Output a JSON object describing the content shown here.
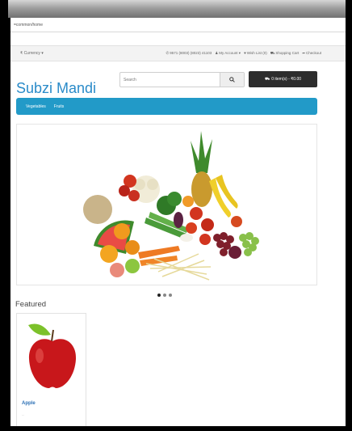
{
  "browser": {
    "url": "=common/home"
  },
  "topbar": {
    "currency": "₹ Currency ▾",
    "phone": "9571 (8003) (8023) 41103",
    "account": "My Account ▾",
    "wishlist": "Wish List (0)",
    "cart_link": "Shopping Cart",
    "checkout": "Checkout"
  },
  "header": {
    "logo": "Subzi Mandi",
    "search_placeholder": "Search",
    "cart_button": "0 item(s) - ₹0.00"
  },
  "nav": {
    "items": [
      "Vegetables",
      "Fruits"
    ]
  },
  "carousel": {
    "slides": 3,
    "active": 0
  },
  "featured": {
    "heading": "Featured",
    "products": [
      {
        "name": "Apple",
        "desc": "..."
      }
    ]
  },
  "colors": {
    "brand": "#2a8bc9",
    "navbar": "#229ac8",
    "cart_button": "#2d2d2d"
  }
}
